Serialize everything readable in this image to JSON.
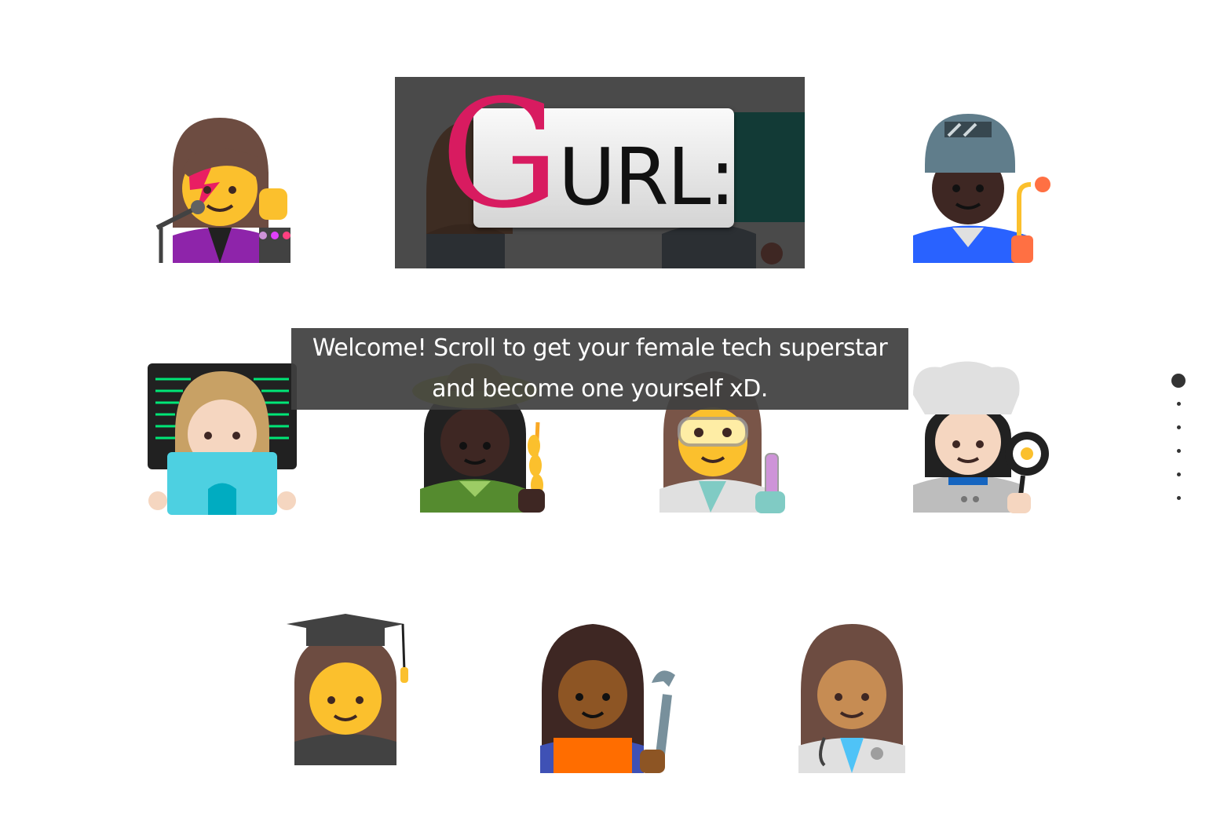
{
  "logo": {
    "first_letter": "G",
    "rest": "URL:",
    "colors": {
      "g": "#d81b60",
      "banner_bg": "#4a4a4a"
    }
  },
  "welcome": {
    "line1": "Welcome! Scroll to get your female tech superstar",
    "line2": "and become one yourself xD."
  },
  "emojis": [
    {
      "name": "woman-singer-icon"
    },
    {
      "name": "woman-factory-worker-icon"
    },
    {
      "name": "woman-technologist-icon"
    },
    {
      "name": "woman-farmer-icon"
    },
    {
      "name": "woman-scientist-icon"
    },
    {
      "name": "woman-cook-icon"
    },
    {
      "name": "woman-student-icon"
    },
    {
      "name": "woman-mechanic-icon"
    },
    {
      "name": "woman-health-worker-icon"
    }
  ],
  "pager": {
    "count": 6,
    "active_index": 0
  }
}
